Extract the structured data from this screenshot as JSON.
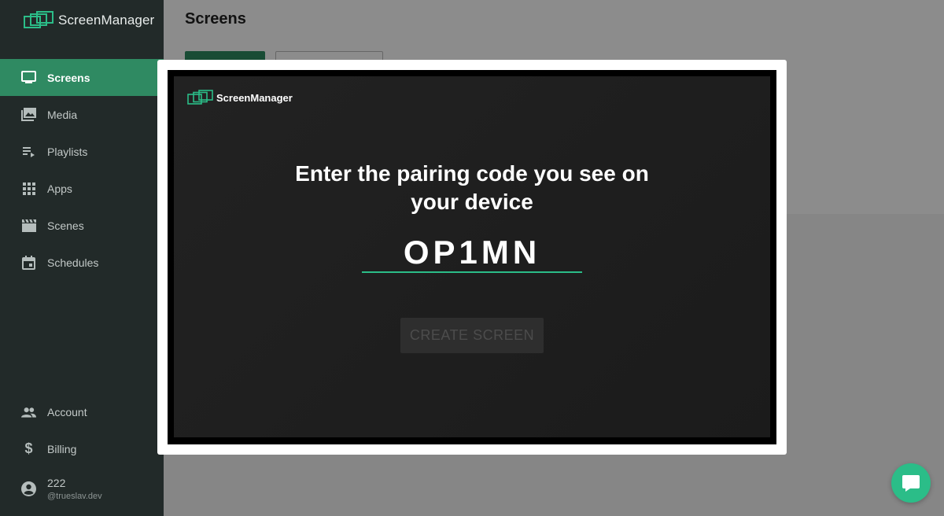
{
  "app": {
    "name": "ScreenManager"
  },
  "sidebar": {
    "items": [
      {
        "label": "Screens",
        "icon": "tv-icon",
        "active": true
      },
      {
        "label": "Media",
        "icon": "photo-library-icon"
      },
      {
        "label": "Playlists",
        "icon": "playlist-icon"
      },
      {
        "label": "Apps",
        "icon": "apps-grid-icon"
      },
      {
        "label": "Scenes",
        "icon": "clapperboard-icon"
      },
      {
        "label": "Schedules",
        "icon": "calendar-icon"
      }
    ],
    "bottom_items": [
      {
        "label": "Account",
        "icon": "people-icon"
      },
      {
        "label": "Billing",
        "icon": "dollar-icon"
      }
    ],
    "user": {
      "name": "222",
      "handle": "@trueslav.dev"
    }
  },
  "main": {
    "title": "Screens"
  },
  "modal": {
    "logo_text": "ScreenManager",
    "headline_line1": "Enter the pairing code you see on",
    "headline_line2": "your device",
    "pairing_code": "OP1MN",
    "create_button": "CREATE SCREEN"
  },
  "colors": {
    "accent": "#2bbd88",
    "sidebar_bg": "#222a29",
    "active_item": "#2f8a62"
  }
}
